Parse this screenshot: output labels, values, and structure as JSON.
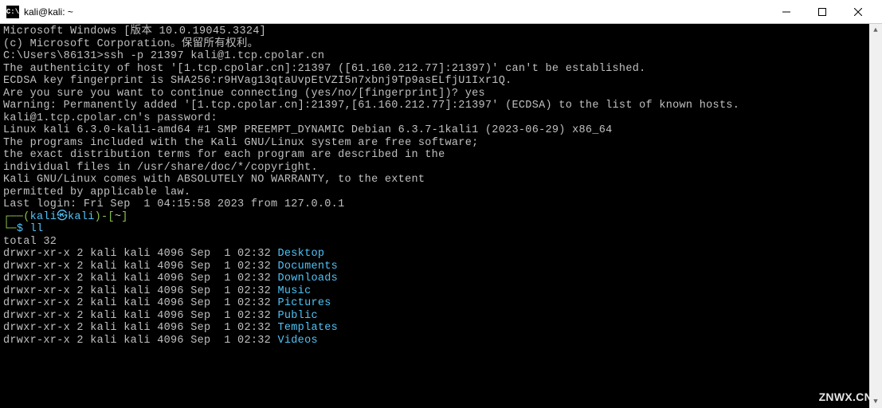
{
  "titlebar": {
    "icon_text": "C:\\",
    "title": "kali@kali: ~"
  },
  "terminal": {
    "line1": "Microsoft Windows [版本 10.0.19045.3324]",
    "line2": "(c) Microsoft Corporation。保留所有权利。",
    "line3": "",
    "prompt1": "C:\\Users\\86131>",
    "cmd1": "ssh -p 21397 kali@1.tcp.cpolar.cn",
    "line4": "The authenticity of host '[1.tcp.cpolar.cn]:21397 ([61.160.212.77]:21397)' can't be established.",
    "line5": "ECDSA key fingerprint is SHA256:r9HVag13qtaUvpEtVZI5n7xbnj9Tp9asELfjU1Ixr1Q.",
    "line6": "Are you sure you want to continue connecting (yes/no/[fingerprint])? yes",
    "line7": "Warning: Permanently added '[1.tcp.cpolar.cn]:21397,[61.160.212.77]:21397' (ECDSA) to the list of known hosts.",
    "line8": "kali@1.tcp.cpolar.cn's password:",
    "line9": "Linux kali 6.3.0-kali1-amd64 #1 SMP PREEMPT_DYNAMIC Debian 6.3.7-1kali1 (2023-06-29) x86_64",
    "line10": "",
    "line11": "The programs included with the Kali GNU/Linux system are free software;",
    "line12": "the exact distribution terms for each program are described in the",
    "line13": "individual files in /usr/share/doc/*/copyright.",
    "line14": "",
    "line15": "Kali GNU/Linux comes with ABSOLUTELY NO WARRANTY, to the extent",
    "line16": "permitted by applicable law.",
    "line17": "Last login: Fri Sep  1 04:15:58 2023 from 127.0.0.1",
    "prompt_open": "┌──(",
    "prompt_user": "kali㉿kali",
    "prompt_close": ")-[",
    "prompt_path": "~",
    "prompt_end": "]",
    "prompt_line2_open": "└─",
    "prompt_dollar": "$",
    "cmd2": " ll",
    "total": "total 32",
    "ls_prefix": "drwxr-xr-x 2 kali kali 4096 Sep  1 02:32 ",
    "dirs": [
      "Desktop",
      "Documents",
      "Downloads",
      "Music",
      "Pictures",
      "Public",
      "Templates",
      "Videos"
    ]
  },
  "watermark": "ZNWX.CN"
}
